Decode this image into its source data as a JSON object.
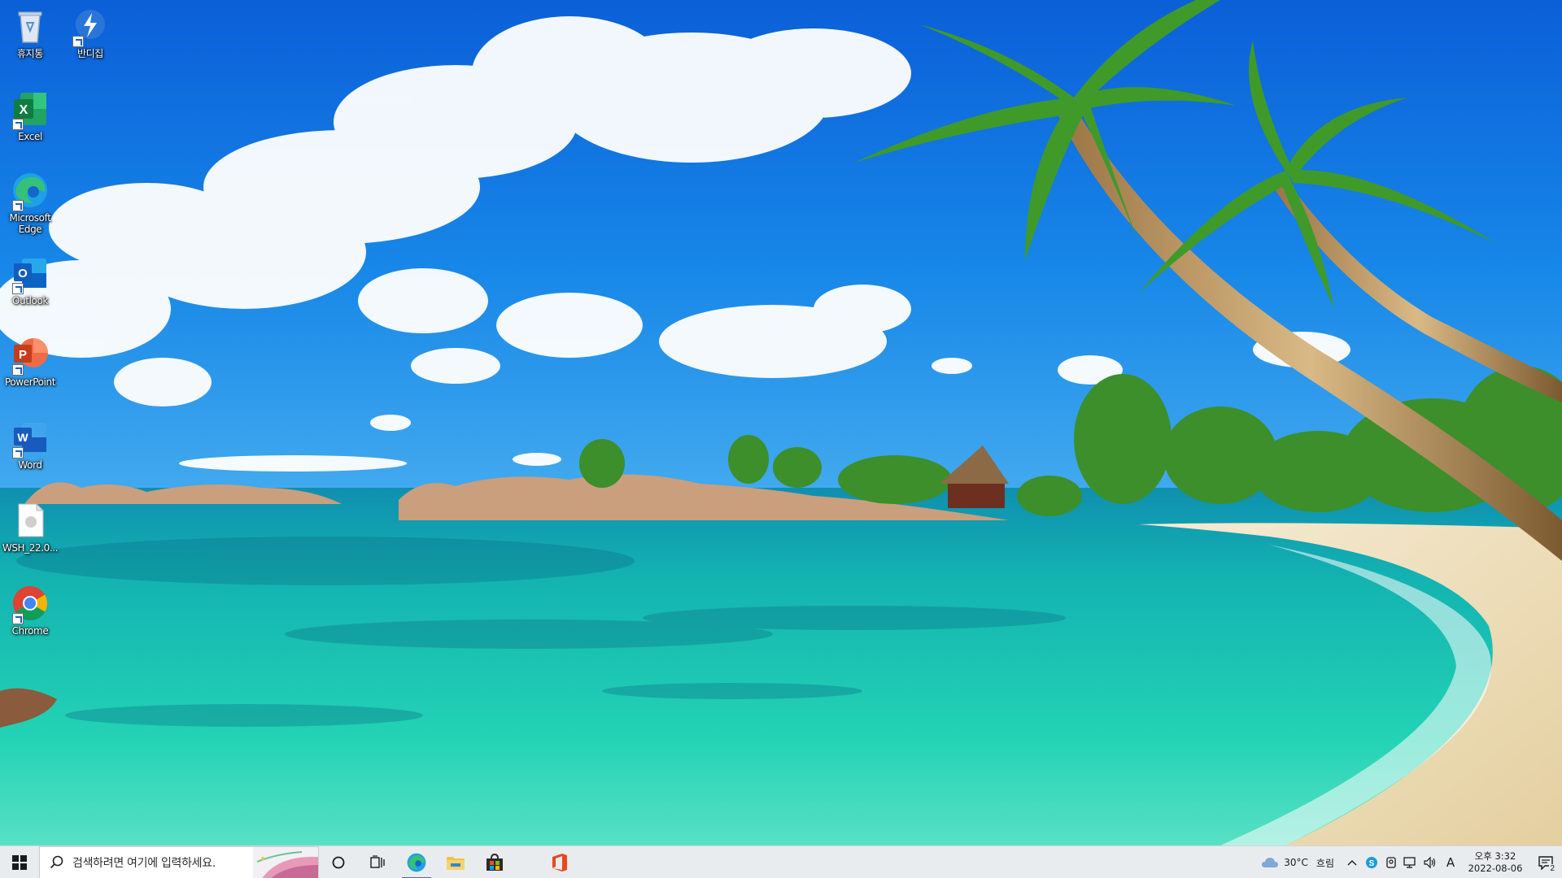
{
  "desktop": {
    "icons": [
      {
        "label": "휴지통",
        "icon": "recycle-bin-icon"
      },
      {
        "label": "반디집",
        "icon": "bandizip-icon"
      },
      {
        "label": "Excel",
        "icon": "excel-icon"
      },
      {
        "label": "Microsoft Edge",
        "icon": "edge-icon"
      },
      {
        "label": "Outlook",
        "icon": "outlook-icon"
      },
      {
        "label": "PowerPoint",
        "icon": "powerpoint-icon"
      },
      {
        "label": "Word",
        "icon": "word-icon"
      },
      {
        "label": "WSH_22.0...",
        "icon": "file-icon"
      },
      {
        "label": "Chrome",
        "icon": "chrome-icon"
      }
    ]
  },
  "taskbar": {
    "search_placeholder": "검색하려면 여기에 입력하세요.",
    "pinned": [
      {
        "name": "cortana",
        "icon": "cortana-icon"
      },
      {
        "name": "task-view",
        "icon": "task-view-icon"
      },
      {
        "name": "edge",
        "icon": "edge-icon",
        "active": true
      },
      {
        "name": "file-explorer",
        "icon": "folder-icon"
      },
      {
        "name": "microsoft-store",
        "icon": "store-icon"
      },
      {
        "name": "office",
        "icon": "office-icon"
      }
    ],
    "tray": {
      "weather_temp": "30°C",
      "weather_desc": "흐림",
      "ime_indicator": "A",
      "time": "오후 3:32",
      "date": "2022-08-06",
      "notification_count": "2"
    }
  },
  "colors": {
    "taskbar_bg": "#e9ecef",
    "active_indicator": "#2f6fd0"
  }
}
